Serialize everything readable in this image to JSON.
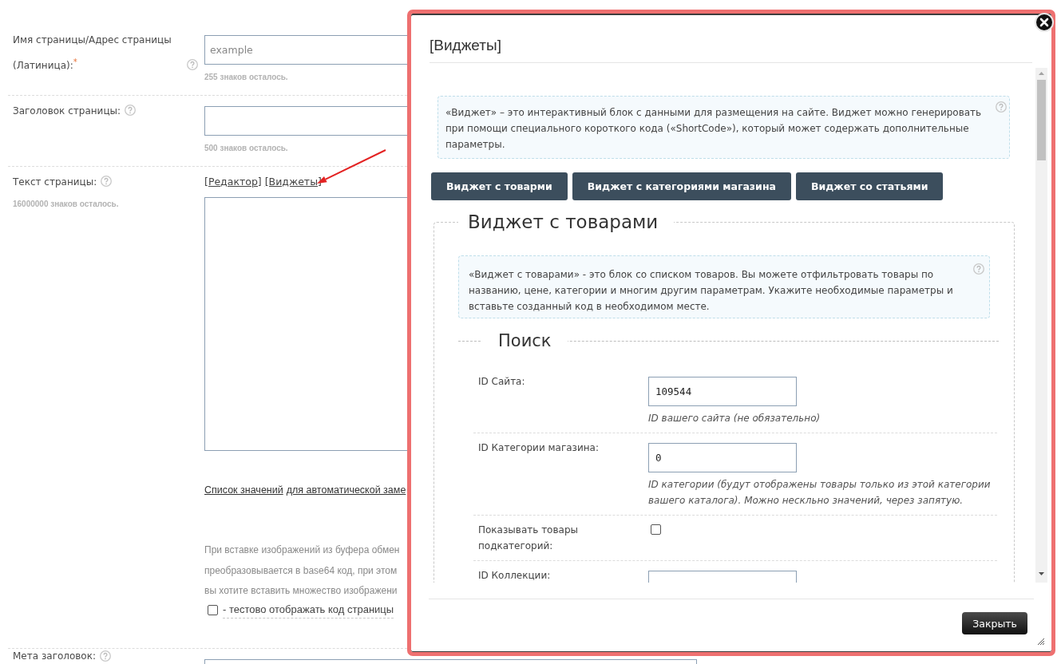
{
  "form": {
    "fields": [
      {
        "kind": "text",
        "label": "Имя страницы/Адрес страницы (Латиница):$^{*}$",
        "placeholder": "example",
        "counter": "255 знаков осталось."
      },
      {
        "kind": "text",
        "label": "Заголовок страницы:",
        "counter": "500 знаков осталось."
      },
      {
        "kind": "editor",
        "label": "Текст страницы:",
        "counter": "16000000 знаков осталось.",
        "editor_links": [
          "[Редактор]",
          "[Виджеты]"
        ],
        "links": [
          "Список значений",
          "для автоматической заме"
        ],
        "note_lines": [
          "При вставке изображений из буфера обмен",
          "преобразовывается в base64 код, при этом",
          "вы хотите вставить множество изображени"
        ],
        "checkbox": {
          "label": "- тестово отображать код страницы",
          "checked": false
        }
      },
      {
        "kind": "text",
        "label": "Мета заголовок:"
      }
    ]
  },
  "modal": {
    "title": "[Виджеты]",
    "intro": "«Виджет» – это интерактивный блок с данными для размещения на сайте. Виджет можно генерировать при помощи специального короткого кода («ShortCode»), который может содержать дополнительные параметры.",
    "widget_buttons": [
      "Виджет с товарми",
      "Виджет с категориями магазина",
      "Виджет со статьями"
    ],
    "section": {
      "title": "Виджет с товарами",
      "intro": "«Виджет с товарами» - это блок со списком товаров. Вы можете отфильтровать товары по названию, цене, категории и многим другим параметрам. Укажите необходимые параметры и вставьте созданный код в необходимом месте.",
      "group": {
        "title": "Поиск",
        "rows": [
          {
            "kind": "input",
            "label": "ID Сайта:",
            "value": "109544",
            "hint": "ID вашего сайта (не обязательно)"
          },
          {
            "kind": "input",
            "label": "ID Категории магазина:",
            "value": "0",
            "hint": "ID категории (будут отображены товары только из этой категории вашего каталога). Можно нескльно значений, через запятую."
          },
          {
            "kind": "checkbox",
            "label": "Показывать товары подкатегорий:",
            "checked": false
          },
          {
            "kind": "input",
            "label": "ID Коллекции:"
          }
        ]
      }
    },
    "close_button": "Закрыть"
  }
}
